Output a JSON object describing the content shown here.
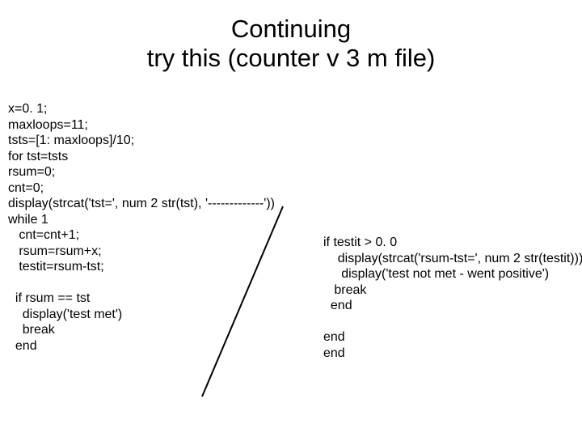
{
  "title": {
    "line1": "Continuing",
    "line2": "try this (counter v 3 m file)"
  },
  "code_left": "x=0. 1;\nmaxloops=11;\ntsts=[1: maxloops]/10;\nfor tst=tsts\nrsum=0;\ncnt=0;\ndisplay(strcat('tst=', num 2 str(tst), '-------------'))\nwhile 1\n   cnt=cnt+1;\n   rsum=rsum+x;\n   testit=rsum-tst;\n\n  if rsum == tst\n    display('test met')\n    break\n  end",
  "code_right": "if testit > 0. 0\n    display(strcat('rsum-tst=', num 2 str(testit)))\n     display('test not met - went positive')\n   break\n  end\n\nend\nend"
}
